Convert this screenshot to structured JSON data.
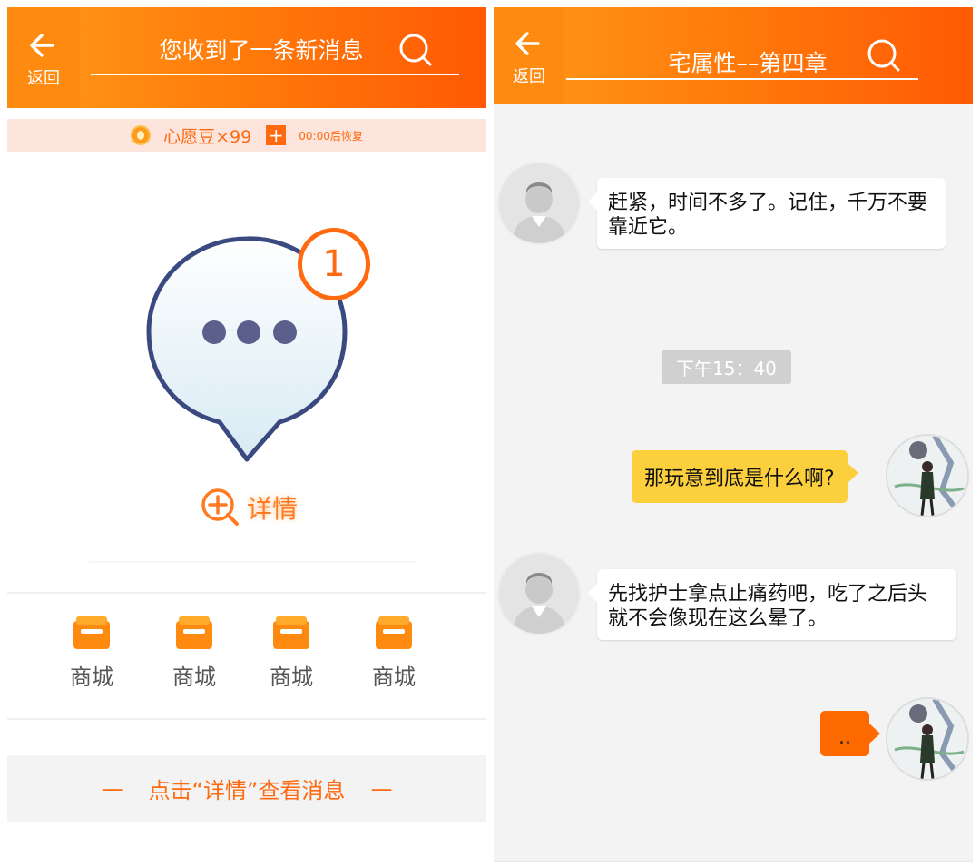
{
  "left": {
    "header": {
      "back_label": "返回",
      "title": "您收到了一条新消息"
    },
    "beans": {
      "label": "心愿豆×99",
      "plus": "+",
      "recover": "00:00后恢复"
    },
    "notification": {
      "badge": "1"
    },
    "details_label": "详情",
    "shop_items": [
      {
        "label": "商城"
      },
      {
        "label": "商城"
      },
      {
        "label": "商城"
      },
      {
        "label": "商城"
      }
    ],
    "hint": {
      "dash_left": "—",
      "text": "点击“详情”查看消息",
      "dash_right": "—"
    }
  },
  "right": {
    "header": {
      "back_label": "返回",
      "title": "宅属性––第四章"
    },
    "messages": [
      {
        "text": "赶紧，时间不多了。记住，千万不要靠近它。"
      },
      {
        "time": "下午15：40"
      },
      {
        "text": "那玩意到底是什么啊?"
      },
      {
        "text": "先找护士拿点止痛药吧，吃了之后头就不会像现在这么晕了。"
      },
      {
        "text": ".."
      }
    ]
  },
  "colors": {
    "accent": "#ff7a0a",
    "bean_bar": "#fde4dc",
    "badge": "#ff6a10",
    "bubble_outline": "#3a4a80",
    "user_bubble": "#fbd03c",
    "user_bubble_orange": "#ff6a00"
  },
  "icons": [
    "back-arrow-icon",
    "search-icon",
    "coin-icon",
    "plus-icon",
    "chat-bubble-icon",
    "zoom-plus-icon",
    "shop-icon"
  ]
}
